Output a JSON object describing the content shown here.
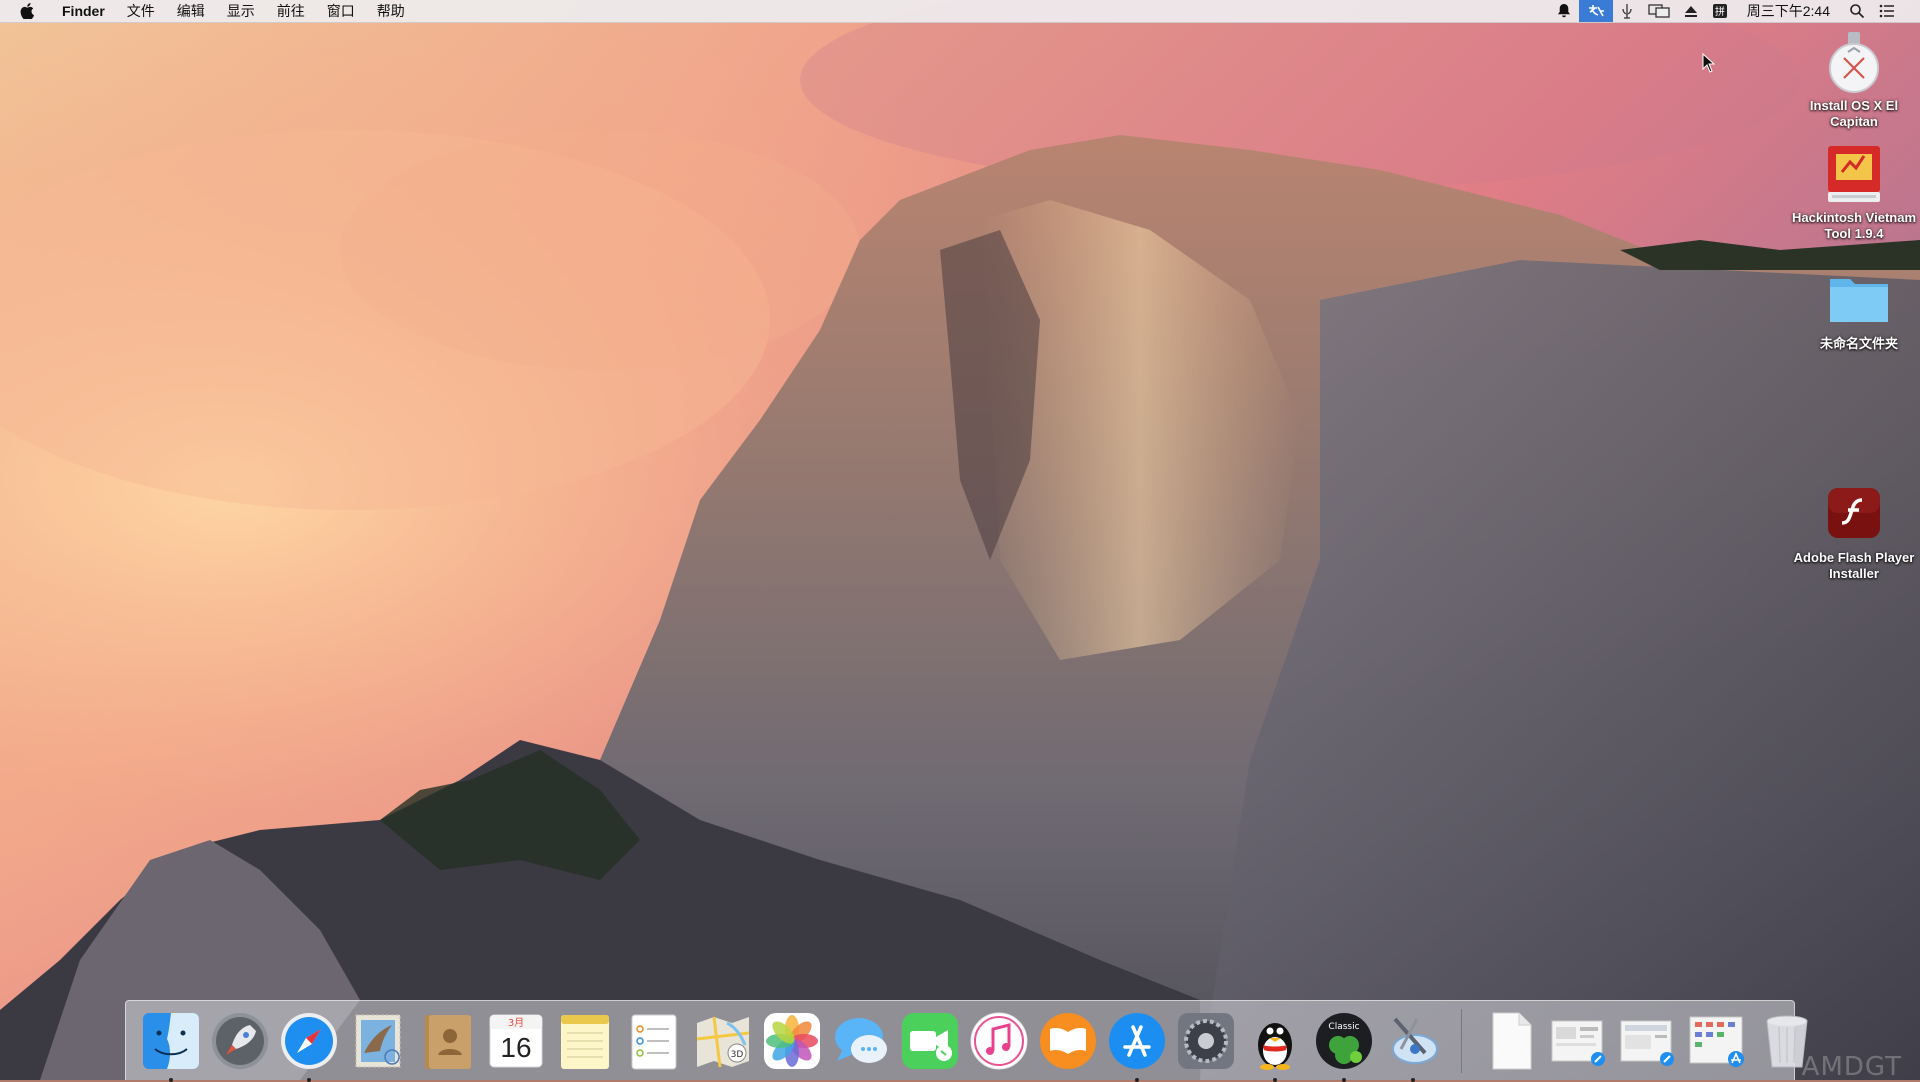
{
  "menubar": {
    "apple_icon": "apple-logo-icon",
    "app_name": "Finder",
    "menus": [
      "文件",
      "编辑",
      "显示",
      "前往",
      "窗口",
      "帮助"
    ],
    "status_icons": [
      "notification-bell-icon",
      "input-method-icon",
      "voice-icon",
      "display-mirror-icon",
      "eject-icon",
      "keyboard-icon"
    ],
    "clock": "周三下午2:44",
    "search_icon": "spotlight-search-icon",
    "notification_center_icon": "list-icon"
  },
  "desktop": {
    "icons": [
      {
        "label": "Install OS X El Capitan",
        "icon": "install-disk-icon"
      },
      {
        "label": "Hackintosh Vietnam Tool 1.9.4",
        "icon": "hackintosh-package-icon"
      },
      {
        "label": "未命名文件夹",
        "icon": "folder-icon"
      },
      {
        "label": "Adobe Flash Player Installer",
        "icon": "flash-icon"
      }
    ]
  },
  "dock": {
    "apps": [
      {
        "name": "finder-dock",
        "icon": "finder-icon",
        "running": true
      },
      {
        "name": "launchpad-dock",
        "icon": "rocket-icon",
        "running": false
      },
      {
        "name": "safari-dock",
        "icon": "compass-icon",
        "running": true
      },
      {
        "name": "mail-dock",
        "icon": "mail-stamp-icon",
        "running": false
      },
      {
        "name": "contacts-dock",
        "icon": "contacts-book-icon",
        "running": false
      },
      {
        "name": "calendar-dock",
        "icon": "calendar-icon",
        "running": false,
        "month": "3月",
        "day": "16"
      },
      {
        "name": "notes-dock",
        "icon": "notes-icon",
        "running": false
      },
      {
        "name": "reminders-dock",
        "icon": "reminders-list-icon",
        "running": false
      },
      {
        "name": "maps-dock",
        "icon": "maps-icon",
        "running": false,
        "badge": "3D"
      },
      {
        "name": "photos-dock",
        "icon": "photos-pinwheel-icon",
        "running": false
      },
      {
        "name": "messages-dock",
        "icon": "chat-bubble-icon",
        "running": false
      },
      {
        "name": "facetime-dock",
        "icon": "video-camera-icon",
        "running": false
      },
      {
        "name": "itunes-dock",
        "icon": "music-note-icon",
        "running": false
      },
      {
        "name": "ibooks-dock",
        "icon": "open-book-icon",
        "running": false
      },
      {
        "name": "appstore-dock",
        "icon": "app-store-icon",
        "running": true
      },
      {
        "name": "system-preferences-dock",
        "icon": "gear-icon",
        "running": false
      },
      {
        "name": "qq-dock",
        "icon": "penguin-icon",
        "running": true
      },
      {
        "name": "clover-dock",
        "icon": "clover-icon",
        "running": true,
        "badge": "Classic"
      },
      {
        "name": "utility-dock",
        "icon": "satellite-tool-icon",
        "running": true
      }
    ],
    "stacks": [
      {
        "name": "document-stack",
        "icon": "blank-document-icon"
      },
      {
        "name": "downloads-stack-1",
        "icon": "screenshot-stack-icon"
      },
      {
        "name": "downloads-stack-2",
        "icon": "screenshot-stack-icon"
      },
      {
        "name": "downloads-stack-3",
        "icon": "app-grid-stack-icon"
      },
      {
        "name": "trash",
        "icon": "trash-icon"
      }
    ]
  },
  "watermark": "AMDGT",
  "colors": {
    "menubar_active": "#3a7bd5"
  }
}
